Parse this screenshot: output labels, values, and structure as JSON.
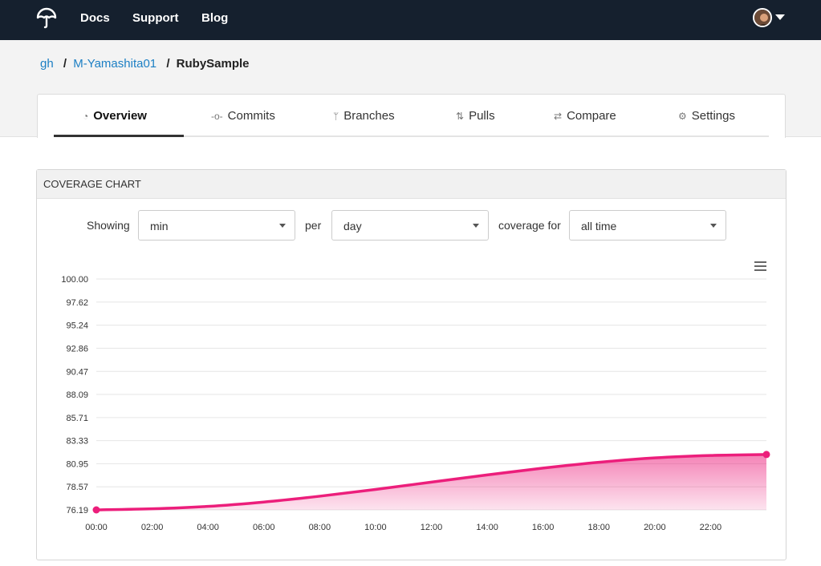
{
  "nav": {
    "links": [
      "Docs",
      "Support",
      "Blog"
    ],
    "logo_icon": "umbrella-logo-icon",
    "avatar_icon": "user-avatar-icon"
  },
  "breadcrumb": {
    "owner_service": "gh",
    "owner": "M-Yamashita01",
    "repo": "RubySample"
  },
  "tabs": [
    {
      "label": "Overview",
      "icon": "gauge-icon",
      "active": true
    },
    {
      "label": "Commits",
      "icon": "commit-icon",
      "active": false
    },
    {
      "label": "Branches",
      "icon": "branch-icon",
      "active": false
    },
    {
      "label": "Pulls",
      "icon": "pull-request-icon",
      "active": false
    },
    {
      "label": "Compare",
      "icon": "compare-icon",
      "active": false
    },
    {
      "label": "Settings",
      "icon": "gear-icon",
      "active": false
    }
  ],
  "panel": {
    "title": "COVERAGE CHART"
  },
  "controls": {
    "showing_label": "Showing",
    "showing_value": "min",
    "per_label": "per",
    "per_value": "day",
    "coverage_label": "coverage for",
    "coverage_value": "all time"
  },
  "colors": {
    "nav_bg": "#15202e",
    "link": "#1c7fc4",
    "series": "#ec1e7b"
  },
  "chart_data": {
    "type": "area",
    "x": [
      "00:00",
      "02:00",
      "04:00",
      "06:00",
      "08:00",
      "10:00",
      "12:00",
      "14:00",
      "16:00",
      "18:00",
      "20:00",
      "22:00",
      "24:00"
    ],
    "x_tick_labels": [
      "00:00",
      "02:00",
      "04:00",
      "06:00",
      "08:00",
      "10:00",
      "12:00",
      "14:00",
      "16:00",
      "18:00",
      "20:00",
      "22:00"
    ],
    "y_ticks": [
      "100.00",
      "97.62",
      "95.24",
      "92.86",
      "90.47",
      "88.09",
      "85.71",
      "83.33",
      "80.95",
      "78.57",
      "76.19"
    ],
    "ylim": [
      76.19,
      100
    ],
    "series": [
      {
        "values": [
          76.19,
          76.3,
          76.55,
          77.0,
          77.6,
          78.3,
          79.05,
          79.8,
          80.5,
          81.1,
          81.55,
          81.8,
          81.9
        ]
      }
    ],
    "markers": [
      0,
      12
    ],
    "grid": true,
    "title": "",
    "xlabel": "",
    "ylabel": ""
  }
}
